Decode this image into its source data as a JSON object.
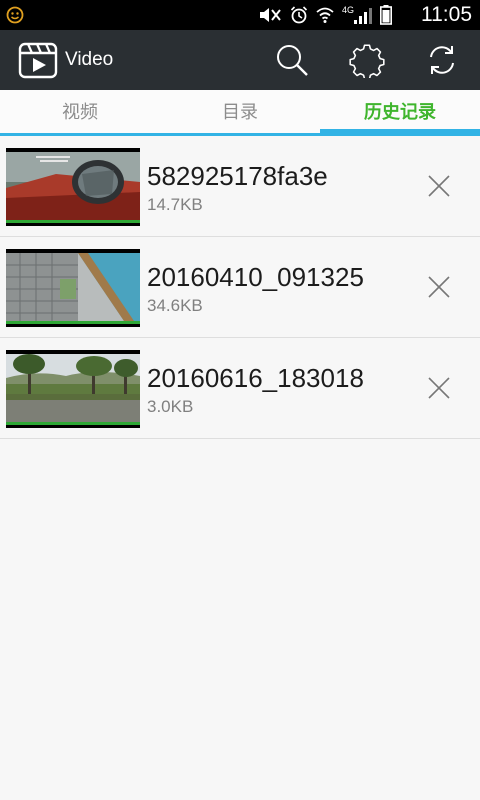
{
  "status_bar": {
    "time": "11:05",
    "network_label": "4G",
    "icons": [
      "notification-face-icon",
      "mute-icon",
      "alarm-icon",
      "wifi-icon",
      "signal-icon",
      "battery-icon"
    ]
  },
  "app_bar": {
    "title": "Video",
    "icons": [
      "video-logo-icon",
      "search-icon",
      "settings-icon",
      "refresh-icon"
    ]
  },
  "tabs": [
    {
      "label": "视频",
      "active": false
    },
    {
      "label": "目录",
      "active": false
    },
    {
      "label": "历史记录",
      "active": true
    }
  ],
  "history": [
    {
      "name": "582925178fa3e",
      "size": "14.7KB",
      "thumbnail": "car-mirror-video-thumbnail"
    },
    {
      "name": "20160410_091325",
      "size": "34.6KB",
      "thumbnail": "building-window-video-thumbnail"
    },
    {
      "name": "20160616_183018",
      "size": "3.0KB",
      "thumbnail": "countryside-field-video-thumbnail"
    }
  ],
  "colors": {
    "status_bar": "#000000",
    "app_bar": "#2a2f33",
    "tab_active": "#3fb52d",
    "tab_inactive": "#8c8c8c",
    "tab_indicator": "#32b3e5",
    "background": "#f7f7f7"
  }
}
